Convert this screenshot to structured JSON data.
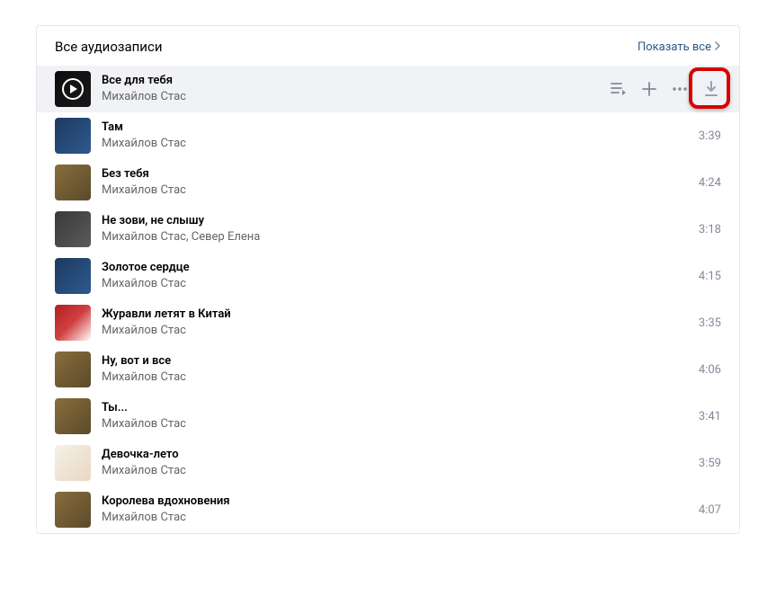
{
  "header": {
    "title": "Все аудиозаписи",
    "show_all": "Показать все"
  },
  "tracks": [
    {
      "title": "Все для тебя",
      "artist": "Михайлов Стас",
      "duration": "",
      "cover": "c1",
      "hovered": true
    },
    {
      "title": "Там",
      "artist": "Михайлов Стас",
      "duration": "3:39",
      "cover": "c2",
      "hovered": false
    },
    {
      "title": "Без тебя",
      "artist": "Михайлов Стас",
      "duration": "4:24",
      "cover": "c3",
      "hovered": false
    },
    {
      "title": "Не зови, не слышу",
      "artist": "Михайлов Стас, Север Елена",
      "duration": "3:18",
      "cover": "c4",
      "hovered": false
    },
    {
      "title": "Золотое сердце",
      "artist": "Михайлов Стас",
      "duration": "4:15",
      "cover": "c2",
      "hovered": false
    },
    {
      "title": "Журавли летят в Китай",
      "artist": "Михайлов Стас",
      "duration": "3:35",
      "cover": "c5",
      "hovered": false
    },
    {
      "title": "Ну, вот и все",
      "artist": "Михайлов Стас",
      "duration": "4:06",
      "cover": "c3",
      "hovered": false
    },
    {
      "title": "Ты...",
      "artist": "Михайлов Стас",
      "duration": "3:41",
      "cover": "c3",
      "hovered": false
    },
    {
      "title": "Девочка-лето",
      "artist": "Михайлов Стас",
      "duration": "3:59",
      "cover": "c6",
      "hovered": false
    },
    {
      "title": "Королева вдохновения",
      "artist": "Михайлов Стас",
      "duration": "4:07",
      "cover": "c3",
      "hovered": false
    }
  ]
}
